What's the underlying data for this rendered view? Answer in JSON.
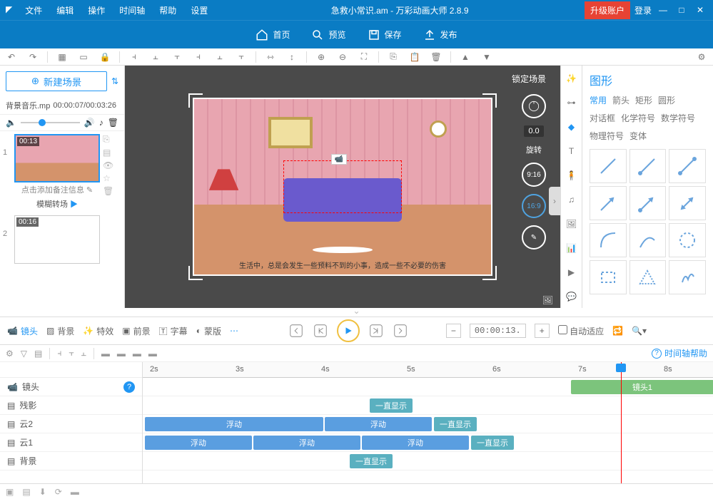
{
  "menu": {
    "file": "文件",
    "edit": "编辑",
    "action": "操作",
    "timeline": "时间轴",
    "help": "帮助",
    "settings": "设置"
  },
  "title": "急救小常识.am - 万彩动画大师 2.8.9",
  "upgrade": "升级账户",
  "login": "登录",
  "maintb": {
    "home": "首页",
    "preview": "预览",
    "save": "保存",
    "publish": "发布"
  },
  "leftpanel": {
    "new_scene": "新建场景",
    "bg_music_file": "背景音乐.mp",
    "bg_music_time": "00:00:07/00:03:26",
    "scenes": [
      {
        "time": "00:13",
        "caption": "点击添加备注信息",
        "transition": "模糊转场"
      },
      {
        "time": "00:16",
        "caption": "",
        "transition": ""
      }
    ]
  },
  "canvas": {
    "lock_scene": "锁定场景",
    "rotate_value": "0.0",
    "rotate_label": "旋转",
    "ratio1": "9:16",
    "ratio2": "16:9",
    "subtitle": "生活中，总是会发生一些预料不到的小事，造成一些不必要的伤害"
  },
  "shapes": {
    "title": "图形",
    "tabs": [
      "常用",
      "箭头",
      "矩形",
      "圆形",
      "对话框",
      "化学符号",
      "数学符号",
      "物理符号",
      "变体"
    ]
  },
  "playback": {
    "tabs": {
      "camera": "镜头",
      "bg": "背景",
      "fx": "特效",
      "fg": "前景",
      "subtitle": "字幕",
      "mask": "蒙版"
    },
    "time": "00:00:13.",
    "autofit": "自动适应"
  },
  "timeline": {
    "help": "时间轴帮助",
    "ticks": [
      "2s",
      "3s",
      "4s",
      "5s",
      "6s",
      "7s",
      "8s"
    ],
    "tracks": {
      "camera": "镜头",
      "shadow": "残影",
      "cloud2": "云2",
      "cloud1": "云1",
      "bg": "背景"
    },
    "clips": {
      "camera1": "镜头1",
      "float": "浮动",
      "always": "一直显示"
    }
  }
}
